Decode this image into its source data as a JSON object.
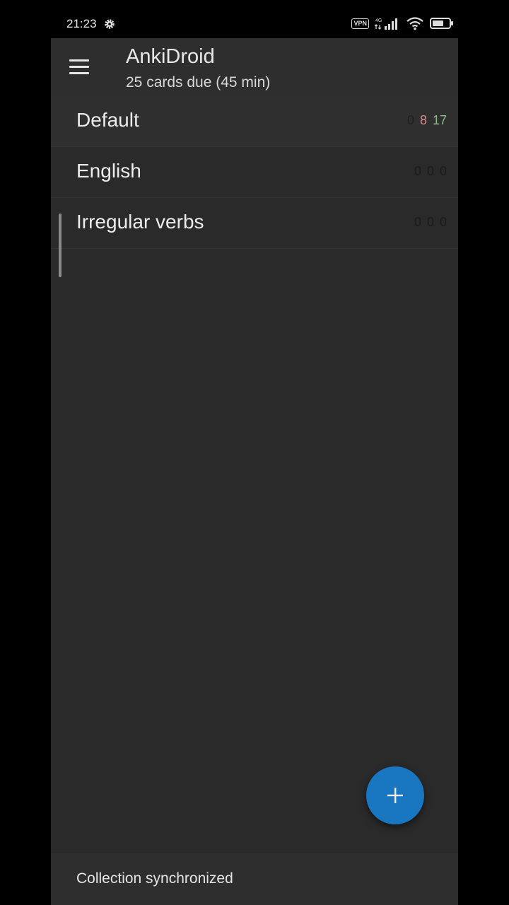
{
  "status_bar": {
    "time": "21:23",
    "vpn_label": "VPN",
    "network_label": "4G",
    "icons": [
      "settings-icon",
      "vpn-icon",
      "signal-icon",
      "wifi-icon",
      "battery-icon"
    ]
  },
  "toolbar": {
    "title": "AnkiDroid",
    "subtitle": "25 cards due (45 min)",
    "menu_icon": "hamburger-menu-icon"
  },
  "decks": [
    {
      "name": "Default",
      "new": "0",
      "learn": "8",
      "review": "17"
    },
    {
      "name": "English",
      "new": "0",
      "learn": "0",
      "review": "0"
    },
    {
      "name": "Irregular verbs",
      "new": "0",
      "learn": "0",
      "review": "0"
    }
  ],
  "fab": {
    "icon": "plus-icon"
  },
  "snackbar": {
    "message": "Collection synchronized"
  },
  "colors": {
    "background": "#2a2a2a",
    "toolbar": "#2e2e2e",
    "fab": "#1976c0",
    "learn_count": "#d98a8a",
    "review_count": "#8bbf86"
  }
}
